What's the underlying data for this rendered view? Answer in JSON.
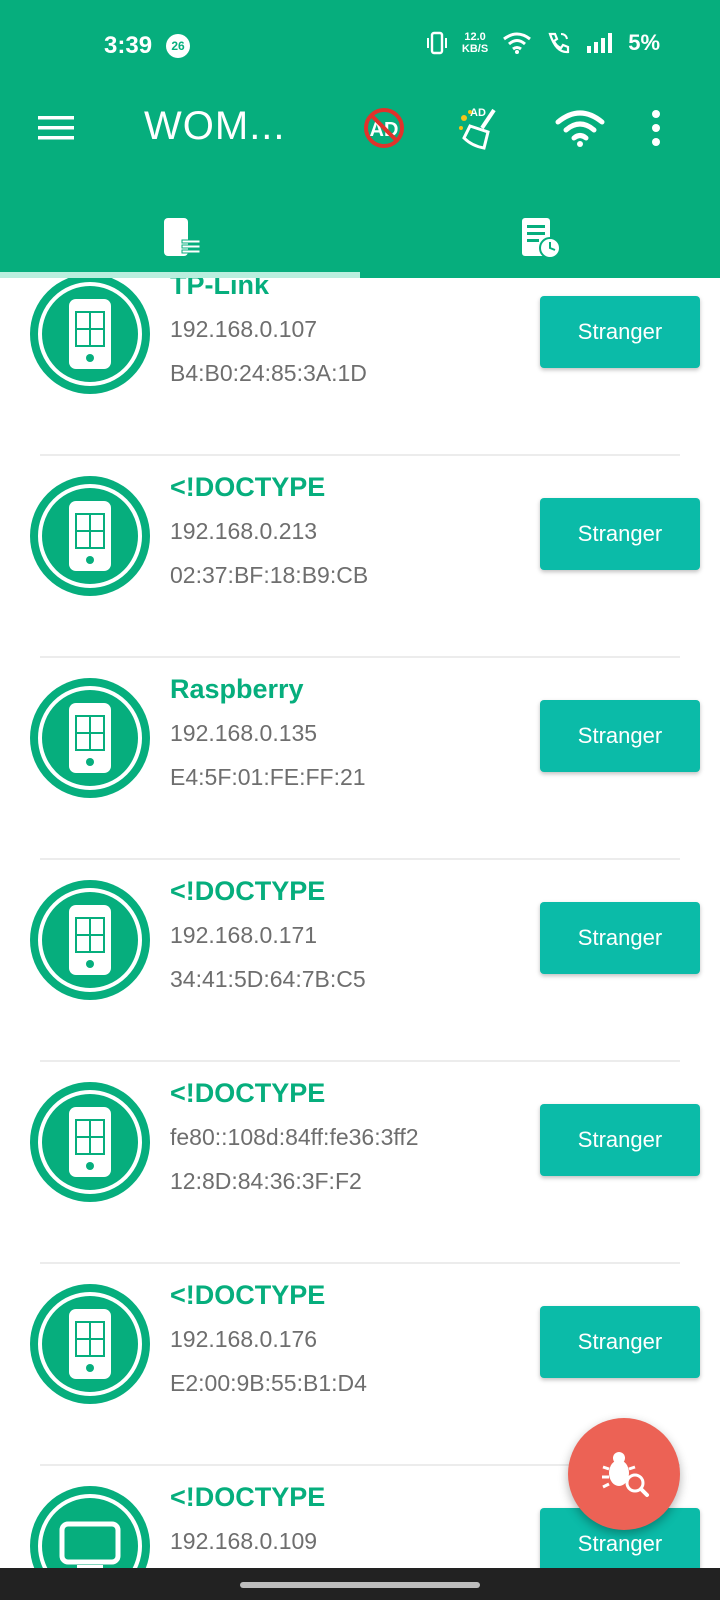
{
  "status_bar": {
    "time": "3:39",
    "notification_count": "26",
    "net_speed_value": "12.0",
    "net_speed_unit": "KB/S",
    "battery": "5%"
  },
  "toolbar": {
    "title": "WOM..."
  },
  "colors": {
    "primary": "#06ae7d",
    "button": "#0bbba8",
    "fab": "#ec6255",
    "secondary_text": "#6e6e6e"
  },
  "devices": [
    {
      "name": "TP-Link",
      "ip": "192.168.0.107",
      "mac": "B4:B0:24:85:3A:1D",
      "button": "Stranger",
      "icon": "phone-icon"
    },
    {
      "name": "<!DOCTYPE",
      "ip": "192.168.0.213",
      "mac": "02:37:BF:18:B9:CB",
      "button": "Stranger",
      "icon": "phone-icon"
    },
    {
      "name": "Raspberry",
      "ip": "192.168.0.135",
      "mac": "E4:5F:01:FE:FF:21",
      "button": "Stranger",
      "icon": "phone-icon"
    },
    {
      "name": "<!DOCTYPE",
      "ip": "192.168.0.171",
      "mac": "34:41:5D:64:7B:C5",
      "button": "Stranger",
      "icon": "phone-icon"
    },
    {
      "name": "<!DOCTYPE",
      "ip": "fe80::108d:84ff:fe36:3ff2",
      "mac": "12:8D:84:36:3F:F2",
      "button": "Stranger",
      "icon": "phone-icon"
    },
    {
      "name": "<!DOCTYPE",
      "ip": "192.168.0.176",
      "mac": "E2:00:9B:55:B1:D4",
      "button": "Stranger",
      "icon": "phone-icon"
    },
    {
      "name": "<!DOCTYPE",
      "ip": "192.168.0.109",
      "mac": "",
      "button": "Stranger",
      "icon": "tv-icon"
    }
  ]
}
